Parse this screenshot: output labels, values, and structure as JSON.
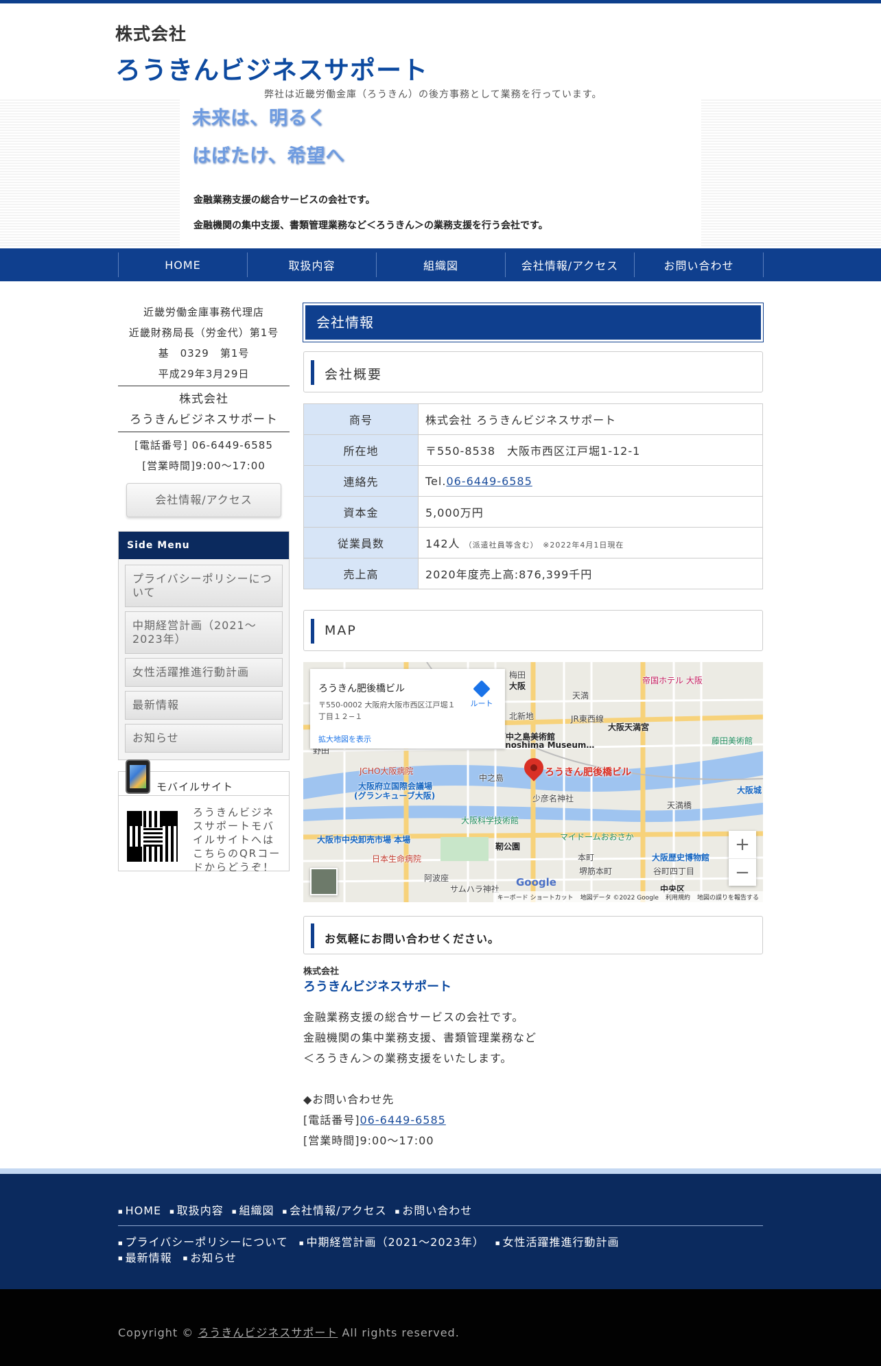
{
  "header": {
    "logo_top": "株式会社",
    "logo_main": "ろうきんビジネスサポート",
    "tagline": "弊社は近畿労働金庫（ろうきん）の後方事務として業務を行っています。"
  },
  "hero": {
    "line1": "未来は、明るく",
    "line2": "はばたけ、希望へ",
    "text1": "金融業務支援の総合サービスの会社です。",
    "text2": "金融機関の集中支援、書類管理業務など＜ろうきん＞の業務支援を行う会社です。"
  },
  "nav": {
    "items": [
      "HOME",
      "取扱内容",
      "組織図",
      "会社情報/アクセス",
      "お問い合わせ"
    ]
  },
  "sidebar": {
    "agency": [
      "近畿労働金庫事務代理店",
      "近畿財務局長（労金代）第1号",
      "基　0329　第1号",
      "平成29年3月29日"
    ],
    "company_name": [
      "株式会社",
      "ろうきんビジネスサポート"
    ],
    "phone": "[電話番号] 06-6449-6585",
    "hours": "[営業時間]9:00～17:00",
    "access_button": "会社情報/アクセス",
    "side_menu_title": "Side Menu",
    "side_menu_items": [
      "プライバシーポリシーについて",
      "中期経営計画（2021～2023年）",
      "女性活躍推進行動計画",
      "最新情報",
      "お知らせ"
    ],
    "mobile_title": "モバイルサイト",
    "mobile_text": "ろうきんビジネスサポートモバイルサイトへはこちらのQRコードからどうぞ！"
  },
  "main": {
    "page_title": "会社情報",
    "overview_heading": "会社概要",
    "table": [
      {
        "k": "商号",
        "v": "株式会社 ろうきんビジネスサポート"
      },
      {
        "k": "所在地",
        "v": "〒550-8538　大阪市西区江戸堀1-12-1"
      },
      {
        "k": "連絡先",
        "v_prefix": "Tel.",
        "v_link": "06-6449-6585"
      },
      {
        "k": "資本金",
        "v": "5,000万円"
      },
      {
        "k": "従業員数",
        "v": "142人",
        "note": "（派遣社員等含む）　※2022年4月1日現在"
      },
      {
        "k": "売上高",
        "v": "2020年度売上高:876,399千円"
      }
    ],
    "map_heading": "MAP",
    "map": {
      "card_name": "ろうきん肥後橋ビル",
      "card_address": "〒550-0002 大阪府大阪市西区江戸堀１丁目１２−１",
      "card_link": "拡大地図を表示",
      "route_label": "ルート",
      "pin_label": "ろうきん肥後橋ビル",
      "google": "Google",
      "zoom_in": "+",
      "zoom_out": "−",
      "footer": [
        "キーボード ショートカット",
        "地図データ ©2022 Google",
        "利用規約",
        "地図の誤りを報告する"
      ],
      "labels": {
        "osaka": "大阪",
        "umeda": "梅田",
        "teikoku": "帝国ホテル 大阪",
        "tenma": "天満",
        "nakanoshima_museum": "中之島美術館",
        "nakanoshima_museum_en": "Nakanoshima Museum…",
        "kitashinchi": "北新地",
        "jr_tozai": "JR東西線",
        "osaka_tenmangu": "大阪天満宮",
        "fujita": "藤田美術館",
        "jcho": "JCHO大阪病院",
        "noda": "野田",
        "kokusai": "大阪府立国際会議場",
        "grancube": "(グランキューブ大阪)",
        "nakanoshima": "中之島",
        "shonen": "少彦名神社",
        "tenmabashi": "天満橋",
        "osaka_castle": "大阪城",
        "kagakukan": "大阪科学技術館",
        "utsubo": "靭公園",
        "mydome": "マイドームおおさか",
        "market": "大阪市中央卸売市場 本場",
        "nissei": "日本生命病院",
        "rekishi": "大阪歴史博物館",
        "honmachi": "本町",
        "sakaisuji": "堺筋本町",
        "tanimachi": "谷町四丁目",
        "awaza": "阿波座",
        "samuhara": "サムハラ神社",
        "chuo": "中央区"
      }
    },
    "contact_heading": "お気軽にお問い合わせください。",
    "contact_logo_top": "株式会社",
    "contact_logo_main": "ろうきんビジネスサポート",
    "contact_lines": [
      "金融業務支援の総合サービスの会社です。",
      "金融機関の集中業務支援、書類管理業務など",
      "＜ろうきん＞の業務支援をいたします。"
    ],
    "inquiry_label": "◆お問い合わせ先",
    "inquiry_phone_prefix": "[電話番号]",
    "inquiry_phone": "06-6449-6585",
    "inquiry_hours": "[営業時間]9:00～17:00"
  },
  "footer": {
    "row1": [
      "HOME",
      "取扱内容",
      "組織図",
      "会社情報/アクセス",
      "お問い合わせ"
    ],
    "row2": [
      "プライバシーポリシーについて",
      "中期経営計画（2021～2023年）",
      "女性活躍推進行動計画",
      "最新情報",
      "お知らせ"
    ],
    "copyright_prefix": "Copyright ©",
    "copyright_link": "ろうきんビジネスサポート",
    "copyright_suffix": "All rights reserved."
  },
  "colors": {
    "brand_navy": "#0f3f8e",
    "dark_navy": "#0b2a5e",
    "table_key_bg": "#d7e5f7"
  }
}
